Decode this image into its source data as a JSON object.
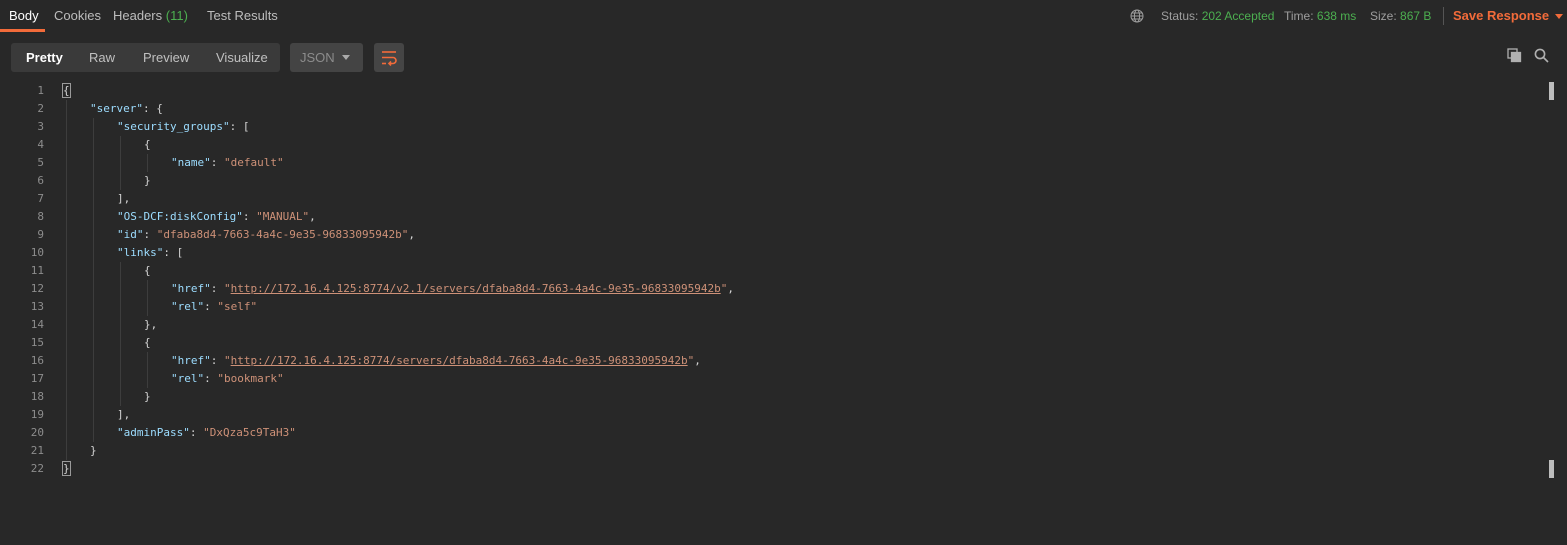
{
  "tabs": {
    "body": "Body",
    "cookies": "Cookies",
    "headers": "Headers",
    "headers_count": "(11)",
    "test_results": "Test Results"
  },
  "status_bar": {
    "status_label": "Status:",
    "status_value": "202 Accepted",
    "time_label": "Time:",
    "time_value": "638 ms",
    "size_label": "Size:",
    "size_value": "867 B",
    "save_response": "Save Response"
  },
  "toolbar": {
    "views": [
      "Pretty",
      "Raw",
      "Preview",
      "Visualize"
    ],
    "active_view": "Pretty",
    "format": "JSON"
  },
  "colors": {
    "accent": "#f26b3a",
    "success": "#4caf50",
    "key": "#9cdcfe",
    "string": "#ce9178",
    "background": "#282828"
  },
  "icons": [
    "globe-icon",
    "wrap-lines-icon",
    "copy-icon",
    "search-icon",
    "caret-down-icon"
  ],
  "code": {
    "line_numbers": [
      "1",
      "2",
      "3",
      "4",
      "5",
      "6",
      "7",
      "8",
      "9",
      "10",
      "11",
      "12",
      "13",
      "14",
      "15",
      "16",
      "17",
      "18",
      "19",
      "20",
      "21",
      "22"
    ],
    "lines": [
      [
        {
          "t": "p",
          "v": "{"
        }
      ],
      [
        {
          "t": "k",
          "v": "\"server\""
        },
        {
          "t": "p",
          "v": ": {"
        }
      ],
      [
        {
          "t": "k",
          "v": "\"security_groups\""
        },
        {
          "t": "p",
          "v": ": ["
        }
      ],
      [
        {
          "t": "p",
          "v": "{"
        }
      ],
      [
        {
          "t": "k",
          "v": "\"name\""
        },
        {
          "t": "p",
          "v": ": "
        },
        {
          "t": "s",
          "v": "\"default\""
        }
      ],
      [
        {
          "t": "p",
          "v": "}"
        }
      ],
      [
        {
          "t": "p",
          "v": "],"
        }
      ],
      [
        {
          "t": "k",
          "v": "\"OS-DCF:diskConfig\""
        },
        {
          "t": "p",
          "v": ": "
        },
        {
          "t": "s",
          "v": "\"MANUAL\""
        },
        {
          "t": "p",
          "v": ","
        }
      ],
      [
        {
          "t": "k",
          "v": "\"id\""
        },
        {
          "t": "p",
          "v": ": "
        },
        {
          "t": "s",
          "v": "\"dfaba8d4-7663-4a4c-9e35-96833095942b\""
        },
        {
          "t": "p",
          "v": ","
        }
      ],
      [
        {
          "t": "k",
          "v": "\"links\""
        },
        {
          "t": "p",
          "v": ": ["
        }
      ],
      [
        {
          "t": "p",
          "v": "{"
        }
      ],
      [
        {
          "t": "k",
          "v": "\"href\""
        },
        {
          "t": "p",
          "v": ": "
        },
        {
          "t": "s",
          "v": "\""
        },
        {
          "t": "u",
          "v": "http://172.16.4.125:8774/v2.1/servers/dfaba8d4-7663-4a4c-9e35-96833095942b"
        },
        {
          "t": "s",
          "v": "\""
        },
        {
          "t": "p",
          "v": ","
        }
      ],
      [
        {
          "t": "k",
          "v": "\"rel\""
        },
        {
          "t": "p",
          "v": ": "
        },
        {
          "t": "s",
          "v": "\"self\""
        }
      ],
      [
        {
          "t": "p",
          "v": "},"
        }
      ],
      [
        {
          "t": "p",
          "v": "{"
        }
      ],
      [
        {
          "t": "k",
          "v": "\"href\""
        },
        {
          "t": "p",
          "v": ": "
        },
        {
          "t": "s",
          "v": "\""
        },
        {
          "t": "u",
          "v": "http://172.16.4.125:8774/servers/dfaba8d4-7663-4a4c-9e35-96833095942b"
        },
        {
          "t": "s",
          "v": "\""
        },
        {
          "t": "p",
          "v": ","
        }
      ],
      [
        {
          "t": "k",
          "v": "\"rel\""
        },
        {
          "t": "p",
          "v": ": "
        },
        {
          "t": "s",
          "v": "\"bookmark\""
        }
      ],
      [
        {
          "t": "p",
          "v": "}"
        }
      ],
      [
        {
          "t": "p",
          "v": "],"
        }
      ],
      [
        {
          "t": "k",
          "v": "\"adminPass\""
        },
        {
          "t": "p",
          "v": ": "
        },
        {
          "t": "s",
          "v": "\"DxQza5c9TaH3\""
        }
      ],
      [
        {
          "t": "p",
          "v": "}"
        }
      ],
      [
        {
          "t": "p",
          "v": "}"
        }
      ]
    ],
    "indent_levels": [
      0,
      1,
      2,
      3,
      4,
      3,
      2,
      2,
      2,
      2,
      3,
      4,
      4,
      3,
      3,
      4,
      4,
      3,
      2,
      2,
      1,
      0
    ]
  }
}
